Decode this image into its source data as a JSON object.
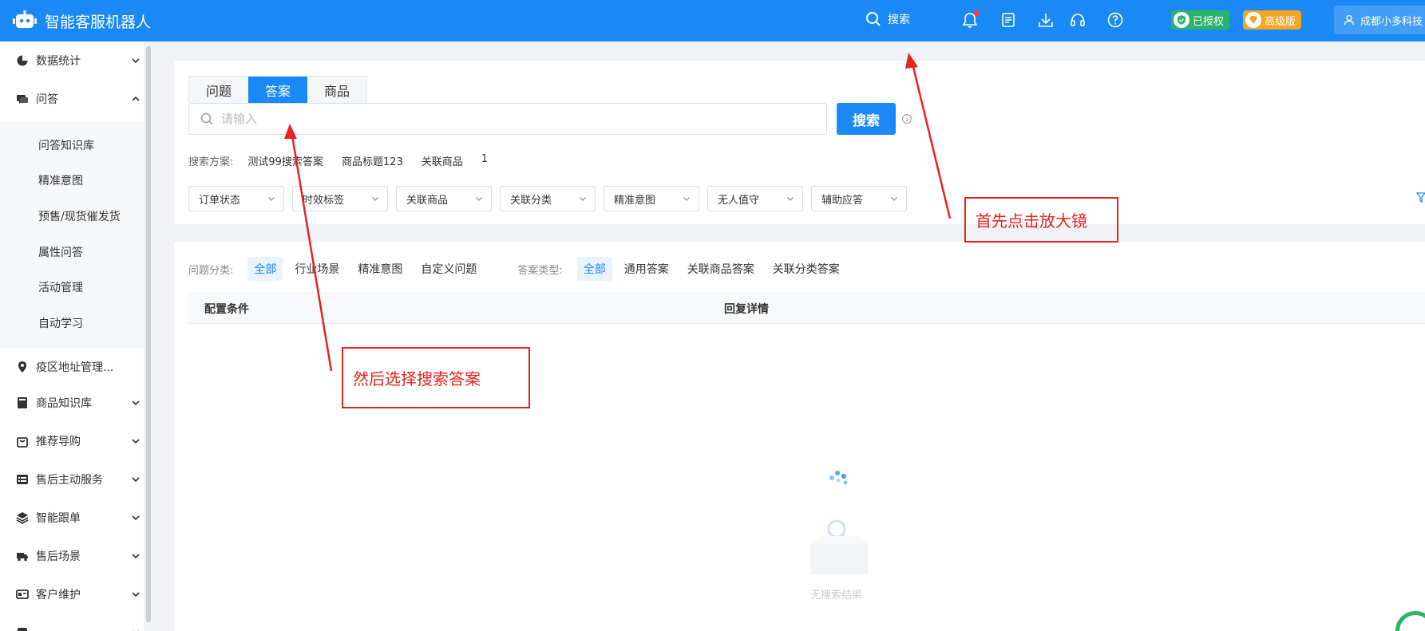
{
  "header": {
    "app_title": "智能客服机器人",
    "search_label": "搜索",
    "auth_badge": "已授权",
    "plan_badge": "高级版",
    "user_name": "成都小多科技"
  },
  "sidebar": {
    "items": [
      {
        "label": "数据统计",
        "icon": "pie-chart-icon"
      },
      {
        "label": "问答",
        "icon": "chat-icon"
      },
      {
        "label": "疫区地址管理...",
        "icon": "location-icon"
      },
      {
        "label": "商品知识库",
        "icon": "book-icon"
      },
      {
        "label": "推荐导购",
        "icon": "bag-icon"
      },
      {
        "label": "售后主动服务",
        "icon": "list-icon"
      },
      {
        "label": "智能跟单",
        "icon": "layers-icon"
      },
      {
        "label": "售后场景",
        "icon": "truck-icon"
      },
      {
        "label": "客户维护",
        "icon": "card-icon"
      }
    ],
    "subitems": [
      "问答知识库",
      "精准意图",
      "预售/现货催发货",
      "属性问答",
      "活动管理",
      "自动学习"
    ]
  },
  "search_panel": {
    "tabs": [
      "问题",
      "答案",
      "商品"
    ],
    "active_tab": "答案",
    "input_placeholder": "请输入",
    "search_button": "搜索",
    "scheme_label": "搜索方案:",
    "schemes": [
      "测试99搜索答案",
      "商品标题123",
      "关联商品",
      "1"
    ],
    "filters": [
      "订单状态",
      "时效标签",
      "关联商品",
      "关联分类",
      "精准意图",
      "无人值守",
      "辅助应答"
    ]
  },
  "results": {
    "question_category_label": "问题分类:",
    "question_categories": [
      "全部",
      "行业场景",
      "精准意图",
      "自定义问题"
    ],
    "answer_type_label": "答案类型:",
    "answer_types": [
      "全部",
      "通用答案",
      "关联商品答案",
      "关联分类答案"
    ],
    "columns": [
      "配置条件",
      "回复详情"
    ],
    "empty_text": "无搜索结果"
  },
  "annotations": {
    "step1": "首先点击放大镜",
    "step2": "然后选择搜索答案"
  },
  "colors": {
    "primary": "#1a89f5",
    "annotation_red": "#e8221f",
    "auth_green": "#2bb36a",
    "plan_orange": "#f5a623"
  }
}
